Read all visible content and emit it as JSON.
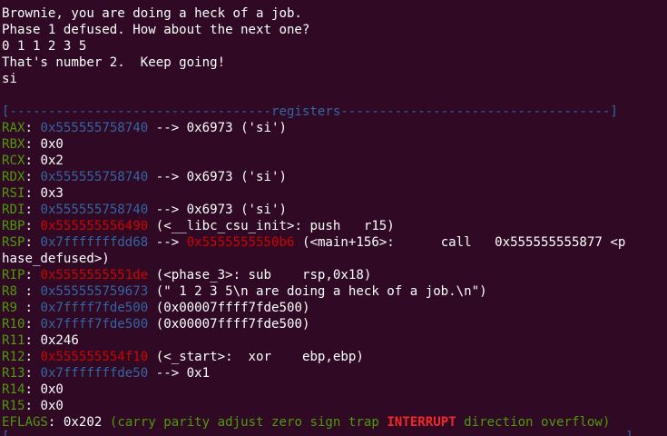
{
  "output": [
    "Brownie, you are doing a heck of a job.",
    "Phase 1 defused. How about the next one?",
    "0 1 1 2 3 5",
    "That's number 2.  Keep going!",
    "si"
  ],
  "registers_header": "[----------------------------------registers-----------------------------------]",
  "registers": {
    "rax": {
      "name": "RAX",
      "value": "0x555555758740",
      "rest": " --> 0x6973 ('si')"
    },
    "rbx": {
      "name": "RBX",
      "value": "0x0"
    },
    "rcx": {
      "name": "RCX",
      "value": "0x2"
    },
    "rdx": {
      "name": "RDX",
      "value": "0x555555758740",
      "rest": " --> 0x6973 ('si')"
    },
    "rsi": {
      "name": "RSI",
      "value": "0x3"
    },
    "rdi": {
      "name": "RDI",
      "value": "0x555555758740",
      "rest": " --> 0x6973 ('si')"
    },
    "rbp": {
      "name": "RBP",
      "value": "0x555555556490",
      "rest": " (<__libc_csu_init>: push   r15)"
    },
    "rsp": {
      "name": "RSP",
      "value": "0x7fffffffdd68",
      "arrow": " --> ",
      "target": "0x5555555550b6",
      "rest": " (<main+156>:      call   0x555555555877 <p",
      "rest2": "hase_defused>)"
    },
    "rip": {
      "name": "RIP",
      "value": "0x5555555551de",
      "rest": " (<phase_3>: sub    rsp,0x18)"
    },
    "r8": {
      "name": "R8 ",
      "value": "0x555555759673",
      "rest": " (\" 1 2 3 5\\n are doing a heck of a job.\\n\")"
    },
    "r9": {
      "name": "R9 ",
      "value": "0x7ffff7fde500",
      "rest": " (0x00007ffff7fde500)"
    },
    "r10": {
      "name": "R10",
      "value": "0x7ffff7fde500",
      "rest": " (0x00007ffff7fde500)"
    },
    "r11": {
      "name": "R11",
      "value": "0x246"
    },
    "r12": {
      "name": "R12",
      "value": "0x555555554f10",
      "rest": " (<_start>:  xor    ebp,ebp)"
    },
    "r13": {
      "name": "R13",
      "value": "0x7fffffffde50",
      "rest": " --> 0x1"
    },
    "r14": {
      "name": "R14",
      "value": "0x0"
    },
    "r15": {
      "name": "R15",
      "value": "0x0"
    }
  },
  "eflags": {
    "name": "EFLAGS",
    "value": "0x202",
    "flags_before": "(carry parity adjust zero sign trap ",
    "flag_set": "INTERRUPT",
    "flags_after": " direction overflow)"
  },
  "colors": {
    "background": "#300a24",
    "register_name": "#4e9a06",
    "pointer_value": "#3465a4",
    "code_pointer": "#cc0000",
    "set_flag": "#ef2929"
  }
}
